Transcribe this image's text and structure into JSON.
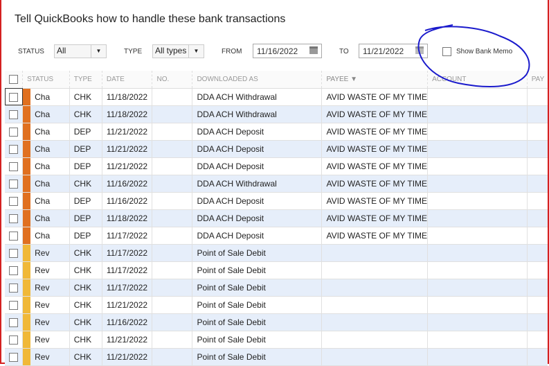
{
  "title": "Tell QuickBooks how to handle these bank transactions",
  "filters": {
    "status_label": "STATUS",
    "status_value": "All",
    "type_label": "TYPE",
    "type_value": "All types",
    "from_label": "FROM",
    "from_value": "11/16/2022",
    "to_label": "TO",
    "to_value": "11/21/2022",
    "show_memo_label": "Show Bank Memo"
  },
  "columns": [
    "STATUS",
    "TYPE",
    "DATE",
    "NO.",
    "DOWNLOADED AS",
    "PAYEE ▼",
    "ACCOUNT",
    "PAY"
  ],
  "colors": {
    "changed": "#e07020",
    "review": "#f0b838",
    "annotation": "#1a1acc"
  },
  "rows": [
    {
      "status": "Cha",
      "type": "CHK",
      "date": "11/18/2022",
      "no": "",
      "downloaded": "DDA ACH Withdrawal",
      "payee": "AVID WASTE OF MY TIME",
      "account": ""
    },
    {
      "status": "Cha",
      "type": "CHK",
      "date": "11/18/2022",
      "no": "",
      "downloaded": "DDA ACH Withdrawal",
      "payee": "AVID WASTE OF MY TIME",
      "account": ""
    },
    {
      "status": "Cha",
      "type": "DEP",
      "date": "11/21/2022",
      "no": "",
      "downloaded": "DDA ACH Deposit",
      "payee": "AVID WASTE OF MY TIME",
      "account": ""
    },
    {
      "status": "Cha",
      "type": "DEP",
      "date": "11/21/2022",
      "no": "",
      "downloaded": "DDA ACH Deposit",
      "payee": "AVID WASTE OF MY TIME",
      "account": ""
    },
    {
      "status": "Cha",
      "type": "DEP",
      "date": "11/21/2022",
      "no": "",
      "downloaded": "DDA ACH Deposit",
      "payee": "AVID WASTE OF MY TIME",
      "account": ""
    },
    {
      "status": "Cha",
      "type": "CHK",
      "date": "11/16/2022",
      "no": "",
      "downloaded": "DDA ACH Withdrawal",
      "payee": "AVID WASTE OF MY TIME",
      "account": ""
    },
    {
      "status": "Cha",
      "type": "DEP",
      "date": "11/16/2022",
      "no": "",
      "downloaded": "DDA ACH Deposit",
      "payee": "AVID WASTE OF MY TIME",
      "account": ""
    },
    {
      "status": "Cha",
      "type": "DEP",
      "date": "11/18/2022",
      "no": "",
      "downloaded": "DDA ACH Deposit",
      "payee": "AVID WASTE OF MY TIME",
      "account": ""
    },
    {
      "status": "Cha",
      "type": "DEP",
      "date": "11/17/2022",
      "no": "",
      "downloaded": "DDA ACH Deposit",
      "payee": "AVID WASTE OF MY TIME",
      "account": ""
    },
    {
      "status": "Rev",
      "type": "CHK",
      "date": "11/17/2022",
      "no": "",
      "downloaded": "Point of Sale Debit",
      "payee": "",
      "account": ""
    },
    {
      "status": "Rev",
      "type": "CHK",
      "date": "11/17/2022",
      "no": "",
      "downloaded": "Point of Sale Debit",
      "payee": "",
      "account": ""
    },
    {
      "status": "Rev",
      "type": "CHK",
      "date": "11/17/2022",
      "no": "",
      "downloaded": "Point of Sale Debit",
      "payee": "",
      "account": ""
    },
    {
      "status": "Rev",
      "type": "CHK",
      "date": "11/21/2022",
      "no": "",
      "downloaded": "Point of Sale Debit",
      "payee": "",
      "account": ""
    },
    {
      "status": "Rev",
      "type": "CHK",
      "date": "11/16/2022",
      "no": "",
      "downloaded": "Point of Sale Debit",
      "payee": "",
      "account": ""
    },
    {
      "status": "Rev",
      "type": "CHK",
      "date": "11/21/2022",
      "no": "",
      "downloaded": "Point of Sale Debit",
      "payee": "",
      "account": ""
    },
    {
      "status": "Rev",
      "type": "CHK",
      "date": "11/21/2022",
      "no": "",
      "downloaded": "Point of Sale Debit",
      "payee": "",
      "account": ""
    }
  ]
}
